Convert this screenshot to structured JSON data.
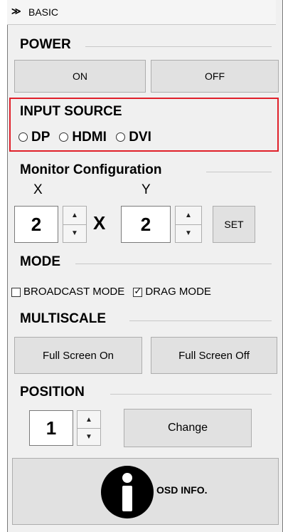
{
  "header": {
    "chevron": "≫",
    "title": "BASIC"
  },
  "power": {
    "title": "POWER",
    "on_label": "ON",
    "off_label": "OFF"
  },
  "input_source": {
    "title": "INPUT SOURCE",
    "options": [
      "DP",
      "HDMI",
      "DVI"
    ],
    "highlight_color": "#e0202a"
  },
  "monitor_config": {
    "title": "Monitor Configuration",
    "x_label": "X",
    "y_label": "Y",
    "x_value": "2",
    "y_value": "2",
    "times": "X",
    "set_label": "SET"
  },
  "mode": {
    "title": "MODE",
    "broadcast_label": "BROADCAST MODE",
    "broadcast_checked": false,
    "drag_label": "DRAG MODE",
    "drag_checked": true
  },
  "multiscale": {
    "title": "MULTISCALE",
    "full_on_label": "Full Screen On",
    "full_off_label": "Full Screen Off"
  },
  "position": {
    "title": "POSITION",
    "value": "1",
    "change_label": "Change"
  },
  "osd": {
    "label": "OSD INFO.",
    "icon": "info-icon"
  }
}
